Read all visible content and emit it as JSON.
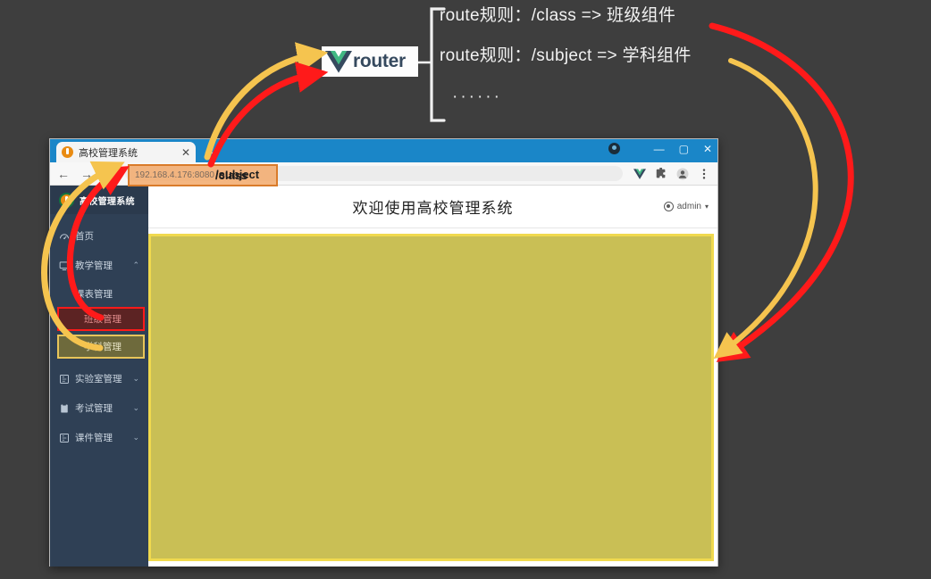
{
  "annotation": {
    "bracket_label": "route-rules-bracket",
    "rules": [
      "route规则：/class =>  班级组件",
      "route规则：/subject => 学科组件",
      "······"
    ],
    "router_logo_text": "router",
    "arrow_colors": {
      "red": "#ff1a1a",
      "yellow": "#f5c44f"
    }
  },
  "browser": {
    "tab": {
      "title": "高校管理系统",
      "close_label": "✕",
      "newtab_label": "+"
    },
    "window_controls": {
      "minimize": "—",
      "maximize": "▢",
      "close": "✕"
    },
    "toolbar": {
      "back": "←",
      "forward": "→",
      "reload": "⟳",
      "url_faint": "192.168.4.176:8080",
      "url_path_a": "/class",
      "url_path_b": "/subject",
      "icons": [
        "vue-devtools-icon",
        "extensions-icon",
        "profile-icon",
        "chrome-menu-icon"
      ]
    }
  },
  "app": {
    "logo_text": "高校管理系统",
    "topbar": {
      "welcome": "欢迎使用高校管理系统",
      "user": "admin",
      "caret": "▾"
    },
    "sidebar": {
      "items": [
        {
          "label": "首页",
          "icon": "dashboard-icon",
          "chevron": "",
          "type": "item"
        },
        {
          "label": "教学管理",
          "icon": "monitor-icon",
          "chevron": "⌃",
          "type": "group"
        },
        {
          "label": "课表管理",
          "icon": "",
          "chevron": "",
          "type": "sub"
        },
        {
          "label": "班级管理",
          "icon": "",
          "chevron": "",
          "type": "sub-highlight-red"
        },
        {
          "label": "学科管理",
          "icon": "",
          "chevron": "",
          "type": "sub-highlight-yellow"
        },
        {
          "label": "实验室管理",
          "icon": "lab-icon",
          "chevron": "⌄",
          "type": "group"
        },
        {
          "label": "考试管理",
          "icon": "exam-icon",
          "chevron": "⌄",
          "type": "group"
        },
        {
          "label": "课件管理",
          "icon": "courseware-icon",
          "chevron": "⌄",
          "type": "group"
        }
      ]
    },
    "colors": {
      "sidebar_bg": "#2f4055",
      "viewport_fill": "#c9bf55",
      "viewport_border": "#f0d94e",
      "browser_chrome": "#1a86c8",
      "page_bg": "#3e3e3e",
      "highlight_red_border": "#ff1a1a",
      "highlight_yellow_border": "#e8c55a"
    }
  }
}
